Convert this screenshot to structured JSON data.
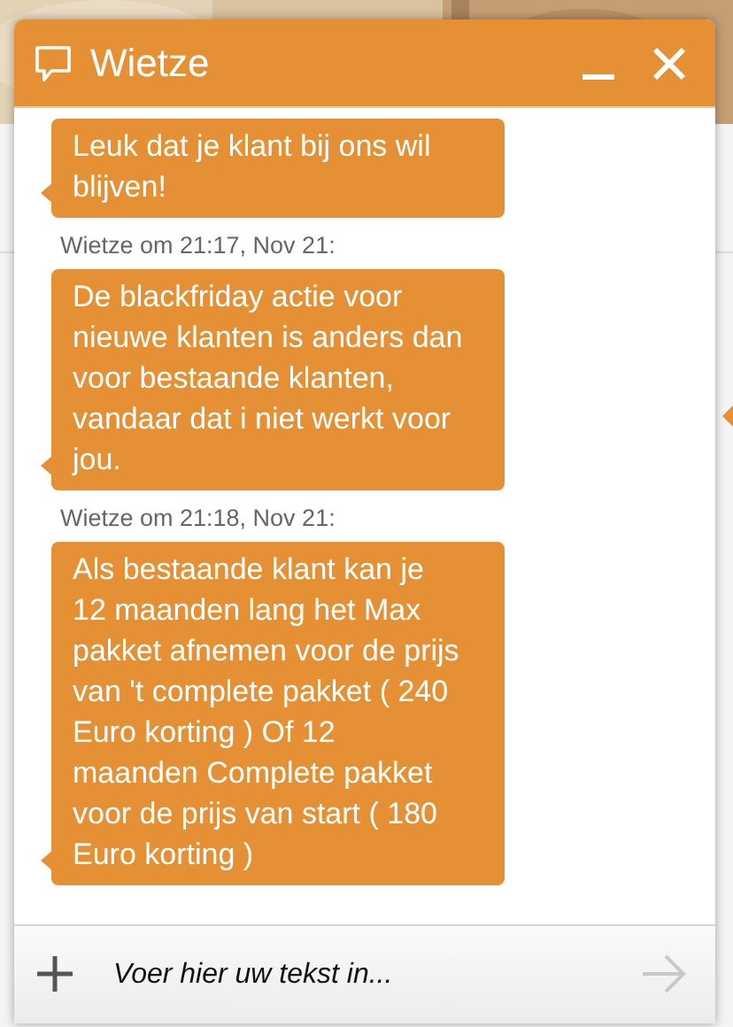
{
  "chat": {
    "title": "Wietze",
    "messages": [
      {
        "text": "Leuk dat je klant bij ons wil blijven!"
      },
      {
        "meta": "Wietze om 21:17, Nov 21:",
        "text": "De blackfriday actie voor nieuwe klanten is anders dan voor bestaande klanten, vandaar dat i niet werkt voor jou."
      },
      {
        "meta": "Wietze om 21:18, Nov 21:",
        "text": "Als bestaande klant kan je 12 maanden lang het Max pakket afnemen voor de prijs van 't complete pakket ( 240 Euro korting ) Of 12 maanden Complete pakket voor de prijs van start ( 180 Euro korting )"
      }
    ],
    "input": {
      "placeholder": "Voer hier uw tekst in..."
    }
  }
}
